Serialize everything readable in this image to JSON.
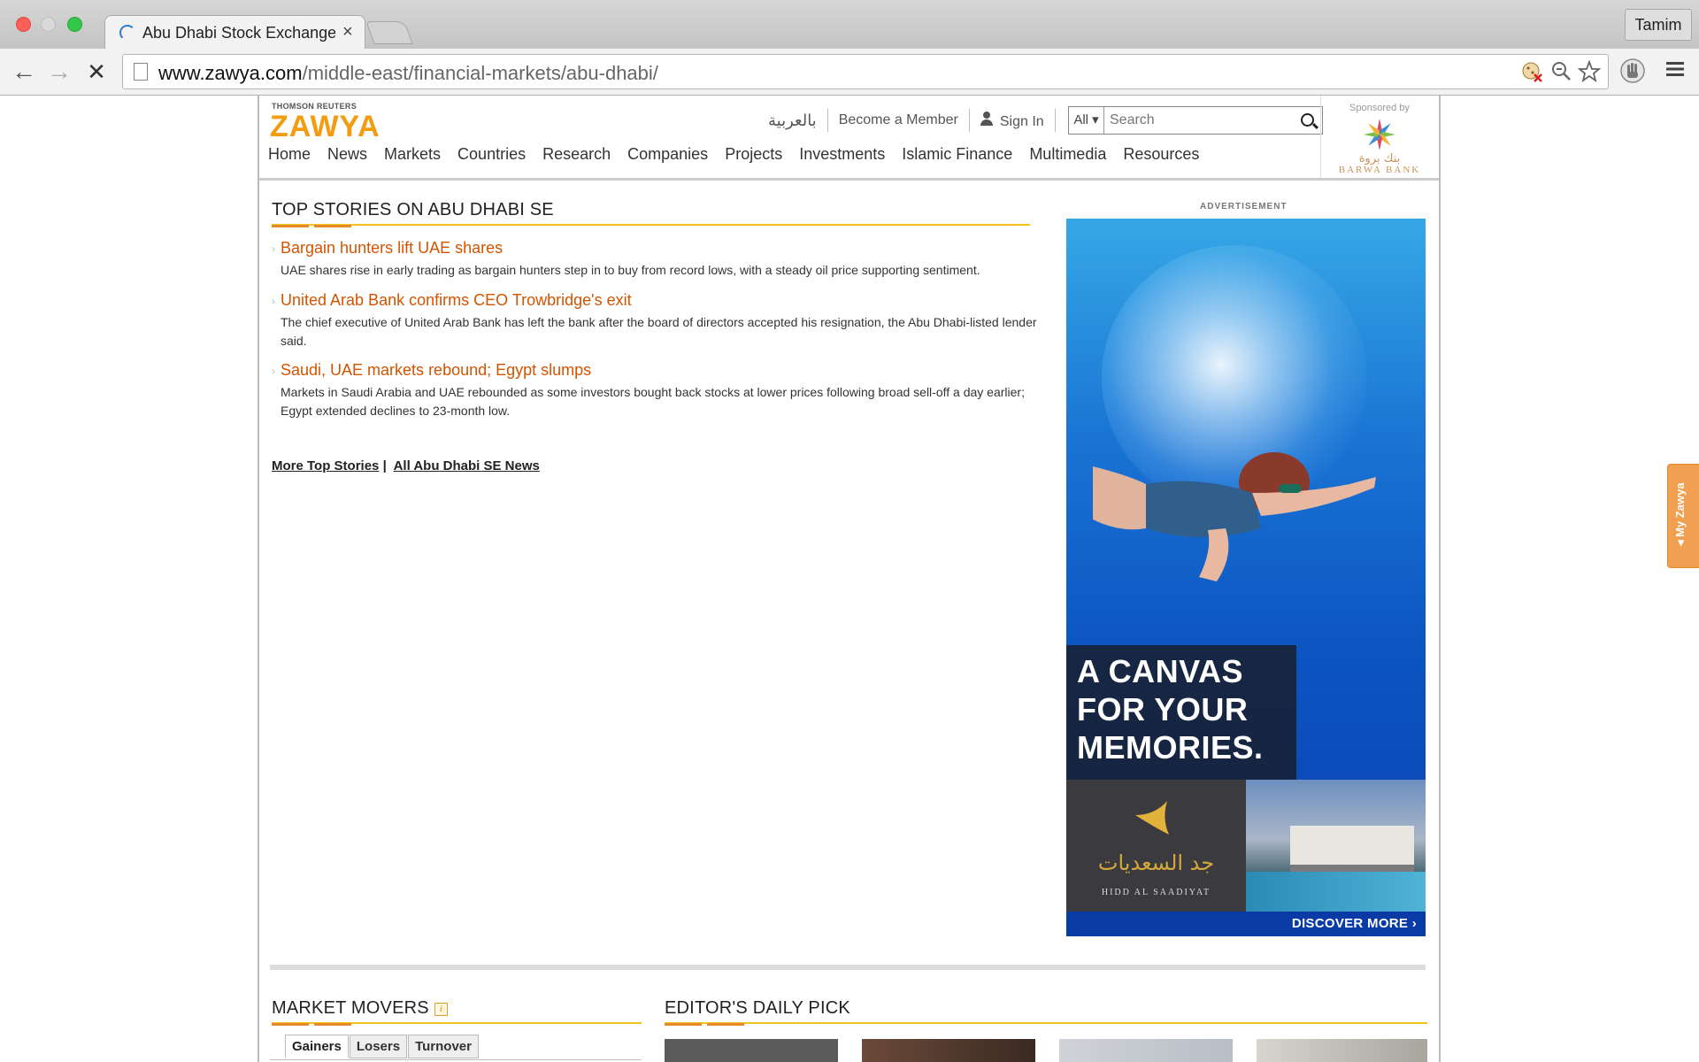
{
  "browser": {
    "tab_title": "Abu Dhabi Stock Exchange",
    "tab_close": "×",
    "profile_name": "Tamim",
    "url_domain": "www.zawya.com",
    "url_path": "/middle-east/financial-markets/abu-dhabi/",
    "back_glyph": "←",
    "forward_glyph": "→",
    "stop_glyph": "✕"
  },
  "header": {
    "logo_small": "THOMSON REUTERS",
    "logo_main": "ZAWYA",
    "arabic_link": "بالعربية",
    "member_link": "Become a Member",
    "signin_link": "Sign In",
    "search_scope": "All ▾",
    "search_placeholder": "Search",
    "sponsor_label": "Sponsored by",
    "sponsor_ar": "بنك بروة",
    "sponsor_en": "BARWA BANK"
  },
  "nav": [
    "Home",
    "News",
    "Markets",
    "Countries",
    "Research",
    "Companies",
    "Projects",
    "Investments",
    "Islamic Finance",
    "Multimedia",
    "Resources"
  ],
  "top_stories": {
    "title": "TOP STORIES ON ABU DHABI SE",
    "items": [
      {
        "headline": "Bargain hunters lift UAE shares",
        "summary": "UAE shares rise in early trading as bargain hunters step in to buy from record lows, with a steady oil price supporting sentiment."
      },
      {
        "headline": "United Arab Bank confirms CEO Trowbridge's exit",
        "summary": "The chief executive of United Arab Bank has left the bank after the board of directors accepted his resignation, the Abu Dhabi-listed lender said."
      },
      {
        "headline": "Saudi, UAE markets rebound; Egypt slumps",
        "summary": "Markets in Saudi Arabia and UAE rebounded as some investors bought back stocks at lower prices following broad sell-off a day earlier; Egypt extended declines to 23-month low."
      }
    ],
    "more_link": "More Top Stories",
    "separator": "|",
    "all_link": "All Abu Dhabi SE News"
  },
  "ad": {
    "label": "ADVERTISEMENT",
    "claim": [
      "A CANVAS",
      "FOR YOUR",
      "MEMORIES."
    ],
    "brand_ar": "جد السعديات",
    "brand_en": "HIDD AL SAADIYAT",
    "cta": "DISCOVER MORE ›"
  },
  "market_movers": {
    "title": "MARKET MOVERS",
    "info": "i",
    "tabs": [
      "Gainers",
      "Losers",
      "Turnover"
    ]
  },
  "editors_pick": {
    "title": "EDITOR'S DAILY PICK"
  },
  "side_widget": "◂ My Zawya"
}
